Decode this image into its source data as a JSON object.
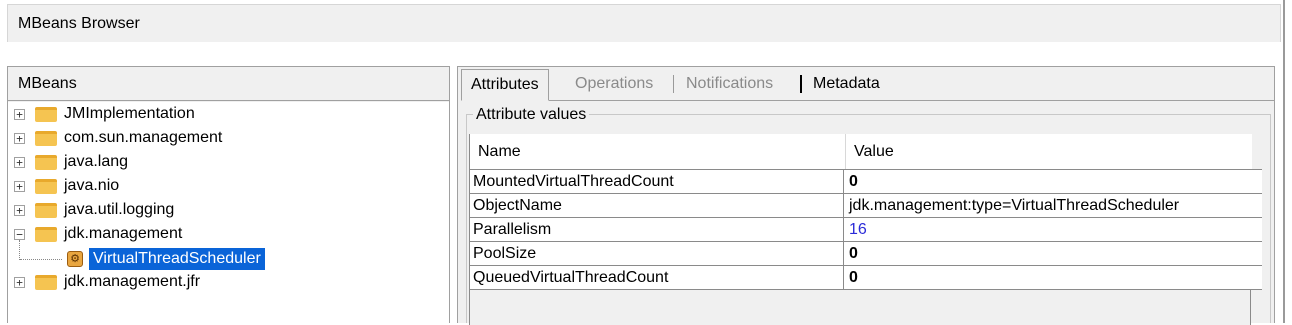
{
  "window": {
    "title": "MBeans Browser"
  },
  "left_panel": {
    "header": "MBeans",
    "tree": [
      {
        "label": "JMImplementation",
        "expander": "+",
        "icon": "folder-icon"
      },
      {
        "label": "com.sun.management",
        "expander": "+",
        "icon": "folder-icon"
      },
      {
        "label": "java.lang",
        "expander": "+",
        "icon": "folder-icon"
      },
      {
        "label": "java.nio",
        "expander": "+",
        "icon": "folder-icon"
      },
      {
        "label": "java.util.logging",
        "expander": "+",
        "icon": "folder-icon"
      },
      {
        "label": "jdk.management",
        "expander": "−",
        "icon": "folder-icon",
        "expanded": true
      },
      {
        "label": "VirtualThreadScheduler",
        "icon": "mbean-icon",
        "selected": true,
        "child": true
      },
      {
        "label": "jdk.management.jfr",
        "expander": "+",
        "icon": "folder-icon"
      }
    ]
  },
  "right_panel": {
    "tabs": [
      {
        "label": "Attributes",
        "active": true
      },
      {
        "label": "Operations",
        "disabled": true
      },
      {
        "label": "Notifications",
        "disabled": true
      },
      {
        "label": "Metadata"
      }
    ],
    "group_title": "Attribute values",
    "table": {
      "columns": [
        "Name",
        "Value"
      ],
      "rows": [
        {
          "name": "MountedVirtualThreadCount",
          "value": "0",
          "style": "bold"
        },
        {
          "name": "ObjectName",
          "value": "jdk.management:type=VirtualThreadScheduler",
          "style": "plain"
        },
        {
          "name": "Parallelism",
          "value": "16",
          "style": "link"
        },
        {
          "name": "PoolSize",
          "value": "0",
          "style": "bold"
        },
        {
          "name": "QueuedVirtualThreadCount",
          "value": "0",
          "style": "bold"
        }
      ]
    }
  },
  "colors": {
    "selection": "#0a64d8",
    "folder": "#f5c451",
    "link_value": "#2b2bd8",
    "panel_bg": "#f0f0f0"
  }
}
